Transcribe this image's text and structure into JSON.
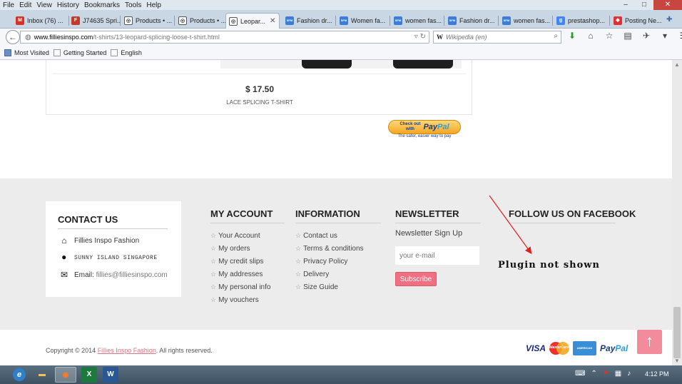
{
  "menu": [
    "File",
    "Edit",
    "View",
    "History",
    "Bookmarks",
    "Tools",
    "Help"
  ],
  "window_controls": {
    "minimize": "–",
    "maximize": "□",
    "close": "✕"
  },
  "tabs": [
    {
      "label": "Inbox (76) ...",
      "icon": "gmail-icon",
      "color": "#d93025",
      "glyph": "M"
    },
    {
      "label": "J74635 Spri...",
      "icon": "f-icon",
      "color": "#c0392b",
      "glyph": "F"
    },
    {
      "label": "Products • ...",
      "icon": "site-icon",
      "color": "#555555",
      "glyph": "◎"
    },
    {
      "label": "Products • ...",
      "icon": "site-icon",
      "color": "#555555",
      "glyph": "◎"
    },
    {
      "label": "Leopar...",
      "icon": "site-icon",
      "color": "#555555",
      "glyph": "◎",
      "active": true
    },
    {
      "label": "Fashion dr...",
      "icon": "sfm-icon",
      "color": "#3b7dd8",
      "glyph": "SFM"
    },
    {
      "label": "Women fa...",
      "icon": "sfm-icon",
      "color": "#3b7dd8",
      "glyph": "SFM"
    },
    {
      "label": "women fas...",
      "icon": "sfm-icon",
      "color": "#3b7dd8",
      "glyph": "SFM"
    },
    {
      "label": "Fashion dr...",
      "icon": "sfm-icon",
      "color": "#3b7dd8",
      "glyph": "SFM"
    },
    {
      "label": "women fas...",
      "icon": "sfm-icon",
      "color": "#3b7dd8",
      "glyph": "SFM"
    },
    {
      "label": "prestashop...",
      "icon": "google-icon",
      "color": "#4285f4",
      "glyph": "g"
    },
    {
      "label": "Posting Ne...",
      "icon": "forum-icon",
      "color": "#e03030",
      "glyph": "◆"
    }
  ],
  "url": {
    "host": "www.filliesinspo.com",
    "path": "/t-shirts/13-leopard-splicing-loose-t-shirt.html"
  },
  "search": {
    "engine": "W",
    "placeholder": "Wikipedia (en)"
  },
  "bookmarks": [
    "Most Visited",
    "Getting Started",
    "English"
  ],
  "product": {
    "price": "$ 17.50",
    "name": "LACE SPLICING T-SHIRT"
  },
  "paypal": {
    "line1": "Check out",
    "line2": "with",
    "brand_a": "Pay",
    "brand_b": "Pal",
    "tagline": "The safer, easier way to pay"
  },
  "contact": {
    "title": "CONTACT US",
    "name": "Fillies Inspo Fashion",
    "address": "SUNNY ISLAND SINGAPORE",
    "email_label": "Email:",
    "email": "fillies@filliesinspo.com"
  },
  "my_account": {
    "title": "MY ACCOUNT",
    "items": [
      "Your Account",
      "My orders",
      "My credit slips",
      "My addresses",
      "My personal info",
      "My vouchers"
    ]
  },
  "information": {
    "title": "INFORMATION",
    "items": [
      "Contact us",
      "Terms & conditions",
      "Privacy Policy",
      "Delivery",
      "Size Guide"
    ]
  },
  "newsletter": {
    "title": "NEWSLETTER",
    "subtitle": "Newsletter Sign Up",
    "placeholder": "your e-mail",
    "button": "Subscribe"
  },
  "facebook": {
    "title": "FOLLOW US ON FACEBOOK",
    "note": "Plugin not shown"
  },
  "copyright": {
    "prefix": "Copyright © 2014 ",
    "link": "Fillies Inspo Fashion",
    "suffix": ". All rights reserved."
  },
  "payment_cards": {
    "visa": "VISA",
    "mastercard": "MasterCard",
    "amex": "AMERICAN EXPRESS",
    "paypal_a": "Pay",
    "paypal_b": "Pal"
  },
  "taskbar": {
    "apps": [
      "ie",
      "explorer",
      "firefox",
      "excel",
      "word"
    ],
    "time": "4:12 PM"
  },
  "colors": {
    "accent_pink": "#f06f80",
    "footer_bg": "#ececec"
  }
}
